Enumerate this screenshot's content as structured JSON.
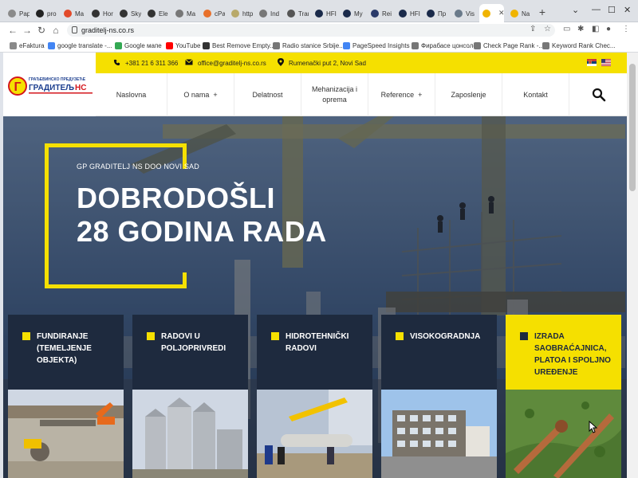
{
  "browser": {
    "tabs": [
      {
        "label": "Pap",
        "color": "#8a8a8a"
      },
      {
        "label": "pro",
        "color": "#222222"
      },
      {
        "label": "Ma",
        "color": "#e24a2a"
      },
      {
        "label": "Hor",
        "color": "#333333"
      },
      {
        "label": "Sky",
        "color": "#333333"
      },
      {
        "label": "Ele",
        "color": "#333333"
      },
      {
        "label": "Ma",
        "color": "#777777"
      },
      {
        "label": "cPa",
        "color": "#e8702a"
      },
      {
        "label": "http",
        "color": "#b8a96a"
      },
      {
        "label": "Ind",
        "color": "#777777"
      },
      {
        "label": "Trar",
        "color": "#555555"
      },
      {
        "label": "HFI",
        "color": "#1a2a4a"
      },
      {
        "label": "My",
        "color": "#1a2a4a"
      },
      {
        "label": "Rei",
        "color": "#2a3a6a"
      },
      {
        "label": "HFI",
        "color": "#1a2a4a"
      },
      {
        "label": "Пр",
        "color": "#1a2a4a"
      },
      {
        "label": "Vis",
        "color": "#6a7a8a"
      },
      {
        "label": "",
        "color": "#f0b400"
      },
      {
        "label": "Na",
        "color": "#f0b400"
      }
    ],
    "active_tab_index": 17,
    "url": "graditelj-ns.co.rs",
    "bookmarks": [
      {
        "label": "eFaktura",
        "color": "#8a8a8a"
      },
      {
        "label": "google translate -...",
        "color": "#4285f4"
      },
      {
        "label": "Google мапе",
        "color": "#34a853"
      },
      {
        "label": "YouTube",
        "color": "#ff0000"
      },
      {
        "label": "Best Remove Empty...",
        "color": "#333333"
      },
      {
        "label": "Radio stanice Srbije...",
        "color": "#777777"
      },
      {
        "label": "PageSpeed Insights",
        "color": "#4285f4"
      },
      {
        "label": "Фирабасе цонсоле",
        "color": "#777777"
      },
      {
        "label": "Check Page Rank -...",
        "color": "#777777"
      },
      {
        "label": "Keyword Rank Chec...",
        "color": "#777777"
      }
    ]
  },
  "topbar": {
    "phone": "+381 21 6 311 366",
    "email": "office@graditelj-ns.co.rs",
    "address": "Rumenački put 2, Novi Sad",
    "bg_color": "#f5e000"
  },
  "logo": {
    "line1": "ГРАЂЕВИНСКО ПРЕДУЗЕЋЕ",
    "line2": "ГРАДИТЕЉ",
    "line3": "НС"
  },
  "nav": {
    "items": [
      {
        "label": "Naslovna",
        "has_plus": false
      },
      {
        "label": "O nama",
        "has_plus": true
      },
      {
        "label": "Delatnost",
        "has_plus": false
      },
      {
        "label": "Mehanizacija i oprema",
        "has_plus": false
      },
      {
        "label": "Reference",
        "has_plus": true
      },
      {
        "label": "Zaposlenje",
        "has_plus": false
      },
      {
        "label": "Kontakt",
        "has_plus": false
      }
    ],
    "plus_glyph": "+"
  },
  "hero": {
    "subtitle": "GP GRADITELJ NS DOO NOVI SAD",
    "title_line1": "DOBRODOŠLI",
    "title_line2": "28 GODINA RADA"
  },
  "cards": [
    {
      "label": "FUNDIRANJE (TEMELJENJE OBJEKTA)",
      "image": "foundation-site",
      "active": false
    },
    {
      "label": "RADOVI U POLJOPRIVREDI",
      "image": "grain-silos",
      "active": false
    },
    {
      "label": "HIDROTEHNIČKI RADOVI",
      "image": "pipe-installation",
      "active": false
    },
    {
      "label": "VISOKOGRADNJA",
      "image": "office-building",
      "active": false
    },
    {
      "label": "IZRADA SAOBRAĆAJNICA, PLATOA I SPOLJNO UREĐENJE",
      "image": "park-aerial",
      "active": true
    }
  ],
  "colors": {
    "brand_yellow": "#f5e000",
    "card_dark": "#1e2a3e",
    "logo_red": "#d4161c",
    "logo_blue": "#1d3f8f"
  }
}
